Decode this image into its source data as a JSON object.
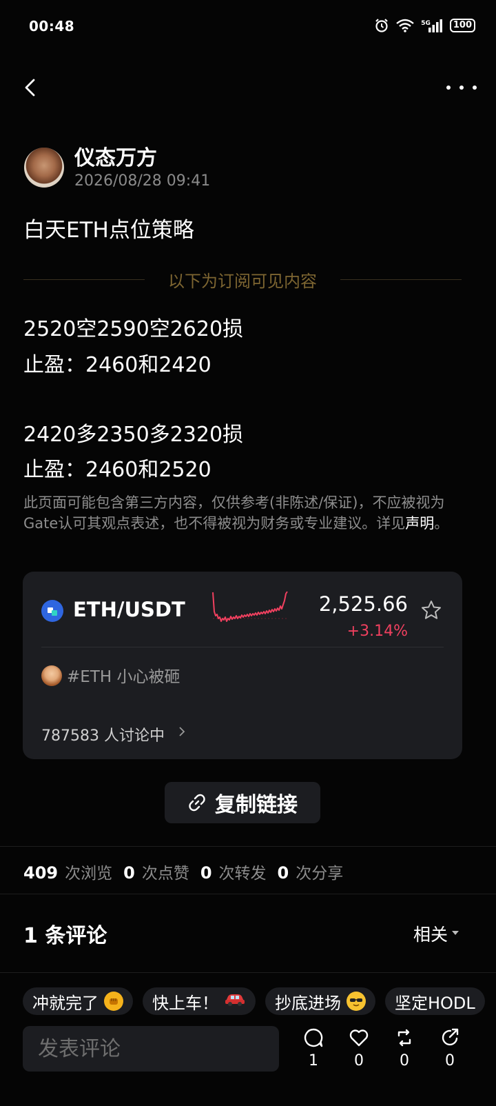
{
  "status_bar": {
    "time": "00:48",
    "network": "5G",
    "battery": "100"
  },
  "author": {
    "name": "仪态万方",
    "time": "2026/08/28 09:41"
  },
  "post": {
    "title": "白天ETH点位策略",
    "subscribe_divider": "以下为订阅可见内容",
    "lines": [
      "2520空2590空2620损",
      "止盈：2460和2420",
      "2420多2350多2320损",
      "止盈：2460和2520"
    ]
  },
  "disclaimer": {
    "text": "此页面可能包含第三方内容，仅供参考(非陈述/保证)，不应被视为Gate认可其观点表述，也不得被视为财务或专业建议。详见",
    "link": "声明",
    "end": "。"
  },
  "ticker": {
    "pair": "ETH/USDT",
    "price": "2,525.66",
    "change": "+3.14%",
    "change_color": "#f0405f",
    "topic": "#ETH 小心被砸",
    "discussing": "787583 人讨论中"
  },
  "copy_link_label": "复制链接",
  "stats": {
    "views": "409",
    "views_label": "次浏览",
    "likes": "0",
    "likes_label": "次点赞",
    "reposts": "0",
    "reposts_label": "次转发",
    "shares": "0",
    "shares_label": "次分享"
  },
  "comments": {
    "title": "1 条评论",
    "sort": "相关"
  },
  "quick_replies": [
    {
      "label": "冲就完了",
      "icon": "fist-emoji"
    },
    {
      "label": "快上车！",
      "icon": "car-emoji"
    },
    {
      "label": "抄底进场",
      "icon": "sunglasses-emoji"
    },
    {
      "label": "坚定HODL",
      "icon": ""
    }
  ],
  "bottom_bar": {
    "input_placeholder": "发表评论",
    "comment_count": "1",
    "like_count": "0",
    "repost_count": "0",
    "share_count": "0"
  },
  "colors": {
    "background": "#050505",
    "card": "#1c1d21",
    "accent_gold": "#7d6531",
    "up_red": "#f0405f",
    "eth_blue": "#2f66e0"
  }
}
